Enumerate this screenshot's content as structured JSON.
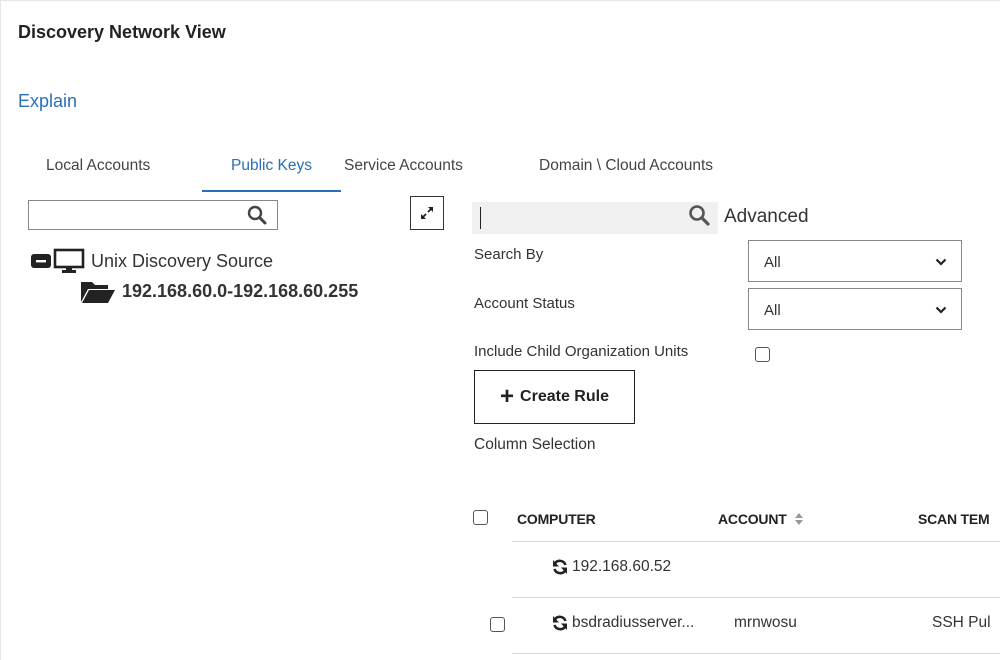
{
  "page": {
    "title": "Discovery Network View",
    "explain_link": "Explain"
  },
  "tabs": [
    {
      "label": "Local Accounts",
      "active": false
    },
    {
      "label": "Public Keys",
      "active": true
    },
    {
      "label": "Service Accounts",
      "active": false
    },
    {
      "label": "Domain \\ Cloud Accounts",
      "active": false
    }
  ],
  "tree": {
    "search_value": "",
    "root": {
      "label": "Unix Discovery Source",
      "icon": "monitor-icon",
      "expanded": true
    },
    "child": {
      "label": "192.168.60.0-192.168.60.255",
      "icon": "folder-open-icon"
    }
  },
  "filters": {
    "search_value": "",
    "advanced_label": "Advanced",
    "search_by": {
      "label": "Search By",
      "value": "All"
    },
    "account_status": {
      "label": "Account Status",
      "value": "All"
    },
    "include_child_ou": {
      "label": "Include Child Organization Units",
      "checked": false
    },
    "create_rule_label": "Create Rule",
    "column_selection_label": "Column Selection"
  },
  "table": {
    "columns": [
      "COMPUTER",
      "ACCOUNT",
      "SCAN TEM"
    ],
    "sort_column": "ACCOUNT",
    "rows": [
      {
        "computer": "192.168.60.52",
        "account": "",
        "scan_template": "",
        "has_checkbox": false,
        "icon": "refresh-icon"
      },
      {
        "computer": "bsdradiusserver...",
        "account": "mrnwosu",
        "scan_template": "SSH Pul",
        "has_checkbox": true,
        "icon": "refresh-icon"
      }
    ]
  },
  "colors": {
    "accent": "#2a6fb8",
    "text": "#222222",
    "border": "#888888"
  }
}
